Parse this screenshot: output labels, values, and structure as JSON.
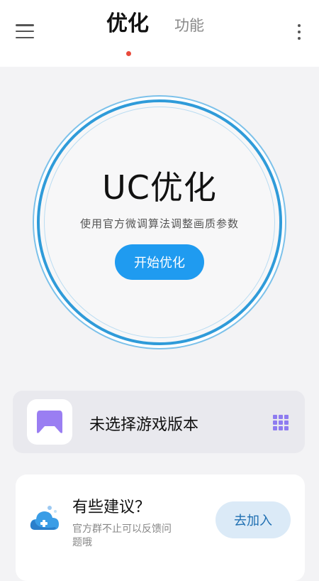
{
  "header": {
    "tabs": [
      {
        "label": "优化",
        "active": true
      },
      {
        "label": "功能",
        "active": false
      }
    ],
    "indicator_color": "#e94a3b"
  },
  "optimizer": {
    "title": "UC优化",
    "subtitle": "使用官方微调算法调整画质参数",
    "start_button": "开始优化",
    "ring_color": "#2f9bd9",
    "button_color": "#1f9bf0"
  },
  "game_selector": {
    "label": "未选择游戏版本",
    "icon": "controller-icon",
    "action_icon": "grid-icon",
    "accent_color": "#8e7cf0"
  },
  "suggestion": {
    "title": "有些建议？",
    "description": "官方群不止可以反馈问题哦",
    "join_button": "去加入",
    "icon": "cloud-icon"
  }
}
